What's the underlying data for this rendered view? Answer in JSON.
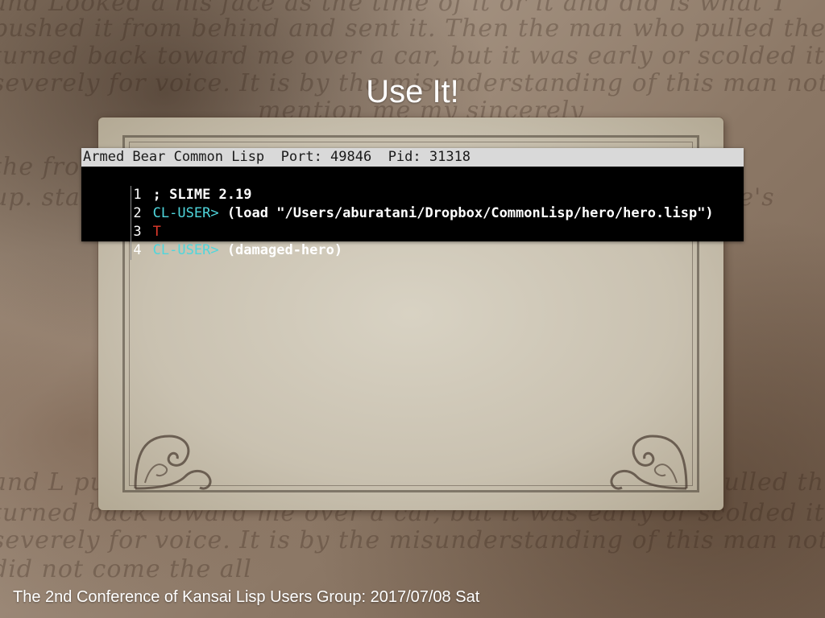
{
  "slide": {
    "title": "Use It!",
    "footer": "The 2nd Conference of Kansai Lisp Users Group: 2017/07/08 Sat"
  },
  "terminal": {
    "header": "Armed Bear Common Lisp  Port: 49846  Pid: 31318",
    "lines": [
      {
        "number": "1",
        "prompt": "",
        "text": "; SLIME 2.19",
        "result": ""
      },
      {
        "number": "2",
        "prompt": "CL-USER>",
        "text": "(load \"/Users/aburatani/Dropbox/CommonLisp/hero/hero.lisp\")",
        "result": ""
      },
      {
        "number": "3",
        "prompt": "",
        "text": "",
        "result": "T"
      },
      {
        "number": "4",
        "prompt": "CL-USER>",
        "text": "(damaged-hero)",
        "result": ""
      }
    ],
    "colors": {
      "background": "#000000",
      "header_bg": "#d9d9d9",
      "prompt": "#4fd6dc",
      "result": "#e03a2c",
      "text": "#ffffff"
    }
  },
  "background_script": [
    "and Looked a his face as the time of it or it and did is what T",
    "pushed it from behind and sent it. Then the man who pulled the car",
    "turned back toward me over a car, but it was early or scolded it",
    "severely for voice. It is by the misunderstanding of this man not to",
    "mention me my sincerely",
    "the front who he would do not have strike fall is the fixed",
    "up. state of the car charcoal the bend a profit a this There's",
    "and L pushed with that and sent it. Then the man who pulled the car",
    "turned back toward me over a car, but it was early or scolded it",
    "severely for voice. It is by the misunderstanding of this man not to",
    "did not come the all"
  ]
}
